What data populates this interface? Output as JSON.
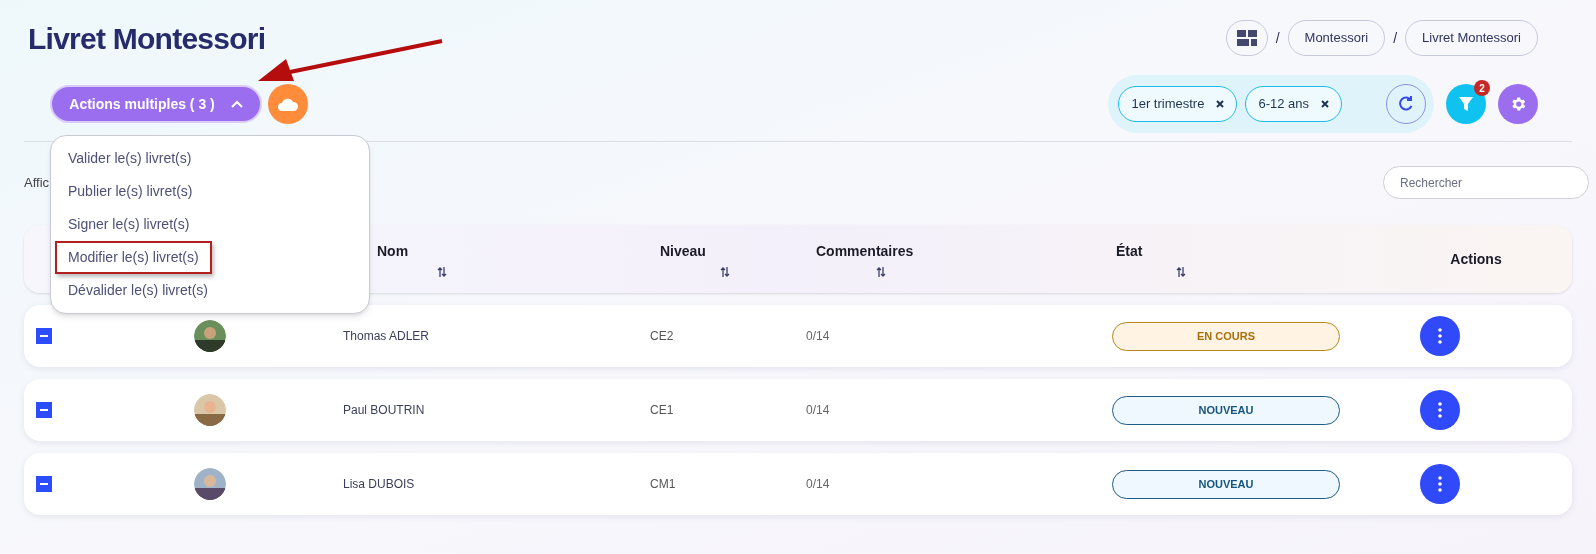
{
  "title": "Livret Montessori",
  "breadcrumb": [
    {
      "separator": "/",
      "label": "Montessori"
    },
    {
      "separator": "/",
      "label": "Livret Montessori"
    }
  ],
  "bulk_button": {
    "label": "Actions multiples ( 3 )",
    "expanded": true
  },
  "bulk_menu": [
    {
      "label": "Valider le(s) livret(s)",
      "highlighted": false
    },
    {
      "label": "Publier le(s) livret(s)",
      "highlighted": false
    },
    {
      "label": "Signer le(s) livret(s)",
      "highlighted": false
    },
    {
      "label": "Modifier le(s) livret(s)",
      "highlighted": true
    },
    {
      "label": "Dévalider le(s) livret(s)",
      "highlighted": false
    }
  ],
  "filters": [
    {
      "label": "1er trimestre"
    },
    {
      "label": "6-12 ans"
    }
  ],
  "filter_badge": "2",
  "show_label": "Affic",
  "search": {
    "placeholder": "Rechercher"
  },
  "columns": [
    {
      "label": "Nom"
    },
    {
      "label": "Niveau"
    },
    {
      "label": "Commentaires"
    },
    {
      "label": "État"
    },
    {
      "label": "Actions"
    }
  ],
  "rows": [
    {
      "selected": true,
      "name": "Thomas ADLER",
      "level": "CE2",
      "comments": "0/14",
      "status": {
        "kind": "in_progress",
        "label": "EN COURS"
      }
    },
    {
      "selected": true,
      "name": "Paul BOUTRIN",
      "level": "CE1",
      "comments": "0/14",
      "status": {
        "kind": "new",
        "label": "NOUVEAU"
      }
    },
    {
      "selected": true,
      "name": "Lisa DUBOIS",
      "level": "CM1",
      "comments": "0/14",
      "status": {
        "kind": "new",
        "label": "NOUVEAU"
      }
    }
  ]
}
